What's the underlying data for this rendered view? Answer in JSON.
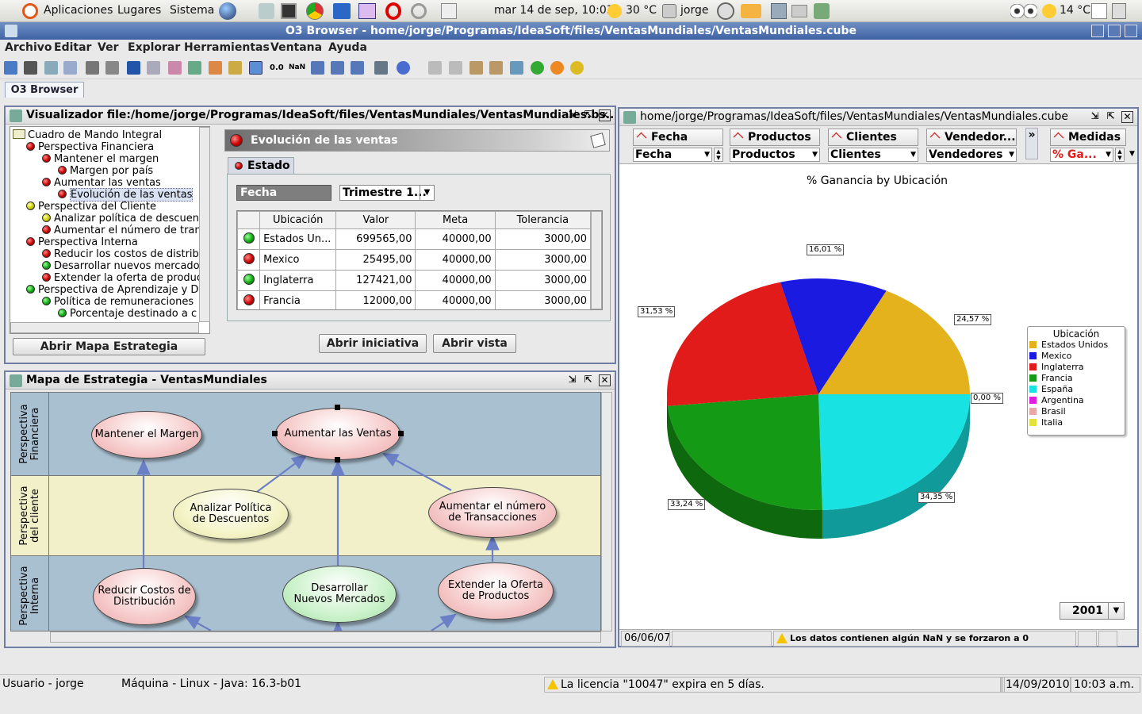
{
  "system_bar": {
    "apps": "Aplicaciones",
    "places": "Lugares",
    "system": "Sistema",
    "datetime": "mar 14 de sep, 10:03",
    "temp": "30 °C",
    "user": "jorge",
    "temp2": "14 °C"
  },
  "window": {
    "title": "O3 Browser - home/jorge/Programas/IdeaSoft/files/VentasMundiales/VentasMundiales.cube"
  },
  "menu": [
    "Archivo",
    "Editar",
    "Ver",
    "Explorar",
    "Herramientas",
    "Ventana",
    "Ayuda"
  ],
  "tab": "O3 Browser",
  "viewer": {
    "title": "Visualizador file:/home/jorge/Programas/IdeaSoft/files/VentasMundiales/VentasMundiales.bs...",
    "tree": [
      {
        "label": "Cuadro de Mando Integral",
        "status": "root"
      },
      {
        "label": "Perspectiva Financiera",
        "status": "red"
      },
      {
        "label": "Mantener el margen",
        "status": "red"
      },
      {
        "label": "Margen por país",
        "status": "red"
      },
      {
        "label": "Aumentar las ventas",
        "status": "red"
      },
      {
        "label": "Evolución de las ventas",
        "status": "red"
      },
      {
        "label": "Perspectiva del Cliente",
        "status": "yellow"
      },
      {
        "label": "Analizar política de descuent",
        "status": "yellow"
      },
      {
        "label": "Aumentar el número de tran",
        "status": "red"
      },
      {
        "label": "Perspectiva Interna",
        "status": "red"
      },
      {
        "label": "Reducir los costos de distrib",
        "status": "red"
      },
      {
        "label": "Desarrollar nuevos mercados",
        "status": "green"
      },
      {
        "label": "Extender la oferta de produc",
        "status": "red"
      },
      {
        "label": "Perspectiva de Aprendizaje y De",
        "status": "green"
      },
      {
        "label": "Política de remuneraciones",
        "status": "green"
      },
      {
        "label": "Porcentaje destinado a c",
        "status": "green"
      }
    ],
    "open_map_button": "Abrir Mapa Estrategia",
    "indicator_title": "Evolución de las ventas",
    "state_tab": "Estado",
    "period_label": "Fecha",
    "period_value": "Trimestre 1...",
    "columns": [
      "Ubicación",
      "Valor",
      "Meta",
      "Tolerancia"
    ],
    "rows": [
      {
        "status": "green",
        "location": "Estados Un...",
        "value": "699565,00",
        "goal": "40000,00",
        "tol": "3000,00"
      },
      {
        "status": "red",
        "location": "Mexico",
        "value": "25495,00",
        "goal": "40000,00",
        "tol": "3000,00"
      },
      {
        "status": "green",
        "location": "Inglaterra",
        "value": "127421,00",
        "goal": "40000,00",
        "tol": "3000,00"
      },
      {
        "status": "red",
        "location": "Francia",
        "value": "12000,00",
        "goal": "40000,00",
        "tol": "3000,00"
      }
    ],
    "open_initiative": "Abrir iniciativa",
    "open_view": "Abrir vista"
  },
  "strategy_map": {
    "title": "Mapa de Estrategia - VentasMundiales",
    "lanes": [
      "Perspectiva Financiera",
      "Perspectiva del cliente",
      "Perspectiva Interna"
    ],
    "lane_colors": [
      "#a9c0d1",
      "#f1f0c9",
      "#a9c0d1"
    ],
    "nodes": [
      "Mantener el Margen",
      "Aumentar las Ventas",
      "Analizar Política de Descuentos",
      "Aumentar el número de Transacciones",
      "Reducir Costos de Distribución",
      "Desarrollar Nuevos Mercados",
      "Extender la Oferta de Productos"
    ]
  },
  "cube": {
    "title": "home/jorge/Programas/IdeaSoft/files/VentasMundiales/VentasMundiales.cube",
    "dims": [
      {
        "name": "Fecha",
        "value": "Fecha"
      },
      {
        "name": "Productos",
        "value": "Productos"
      },
      {
        "name": "Clientes",
        "value": "Clientes"
      },
      {
        "name": "Vendedor...",
        "value": "Vendedores"
      }
    ],
    "more": "»",
    "measures": {
      "name": "Medidas",
      "value": "% Ga..."
    },
    "year": "2001",
    "status_date": "06/06/07",
    "warning": "Los datos contienen algún NaN y se forzaron a 0"
  },
  "chart_data": {
    "type": "pie",
    "title": "% Ganancia by Ubicación",
    "legend_title": "Ubicación",
    "legend_position": "right",
    "categories": [
      "Estados Unidos",
      "Mexico",
      "Inglaterra",
      "Francia",
      "España",
      "Argentina",
      "Brasil",
      "Italia"
    ],
    "values": [
      24.57,
      16.01,
      31.53,
      33.24,
      34.35,
      0,
      0,
      0
    ],
    "data_labels": [
      "24,57 %",
      "16,01 %",
      "31,53 %",
      "33,24 %",
      "34,35 %",
      "0,00 %"
    ],
    "colors": [
      "#e3b21c",
      "#1a1ae0",
      "#e11a1a",
      "#159a15",
      "#18e2e2",
      "#e020e0",
      "#e8a8a8",
      "#e2e23a"
    ]
  },
  "status": {
    "user": "Usuario - jorge",
    "machine": "Máquina - Linux - Java: 16.3-b01",
    "license": "La licencia \"10047\" expira en 5 días.",
    "date": "14/09/2010",
    "time": "10:03 a.m."
  }
}
